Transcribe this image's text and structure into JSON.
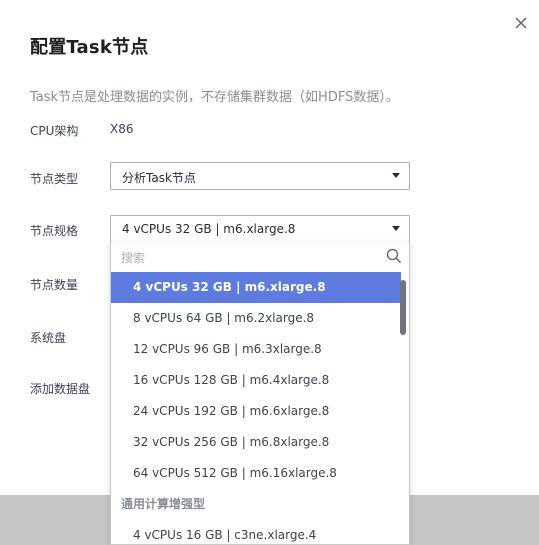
{
  "dialog": {
    "title": "配置Task节点",
    "description": "Task节点是处理数据的实例，不存储集群数据（如HDFS数据）。"
  },
  "fields": {
    "cpu_arch_label": "CPU架构",
    "cpu_arch_value": "X86",
    "node_type_label": "节点类型",
    "node_type_value": "分析Task节点",
    "node_spec_label": "节点规格",
    "node_spec_value": "4 vCPUs 32 GB | m6.xlarge.8",
    "node_count_label": "节点数量",
    "system_disk_label": "系统盘",
    "data_disk_label": "添加数据盘"
  },
  "dropdown": {
    "search_placeholder": "搜索",
    "options": [
      "4 vCPUs 32 GB | m6.xlarge.8",
      "8 vCPUs 64 GB | m6.2xlarge.8",
      "12 vCPUs 96 GB | m6.3xlarge.8",
      "16 vCPUs 128 GB | m6.4xlarge.8",
      "24 vCPUs 192 GB | m6.6xlarge.8",
      "32 vCPUs 256 GB | m6.8xlarge.8",
      "64 vCPUs 512 GB | m6.16xlarge.8"
    ],
    "group_label": "通用计算增强型",
    "group_options": [
      "4 vCPUs 16 GB | c3ne.xlarge.4"
    ],
    "selected_index": 0
  },
  "colors": {
    "accent": "#5e7ce0",
    "text": "#252b3a",
    "muted": "#8a8e99"
  },
  "icons": {
    "close": "close-icon",
    "search": "search-icon",
    "caret": "chevron-down-icon"
  }
}
